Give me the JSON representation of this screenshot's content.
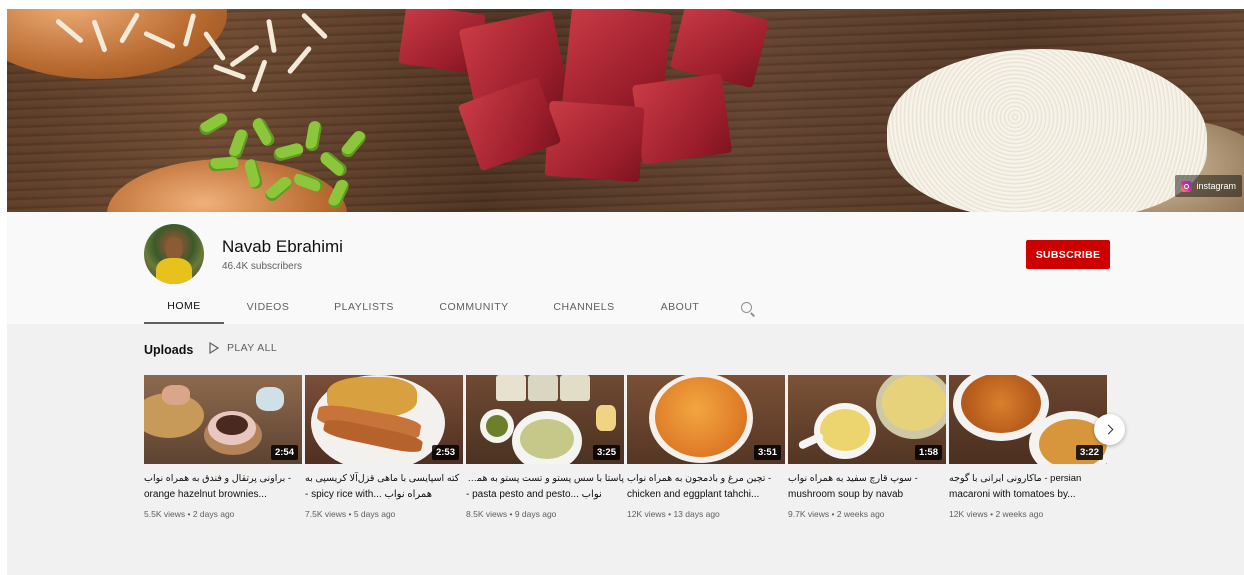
{
  "banner": {
    "social_link_label": "instagram",
    "social_icon": "instagram-icon"
  },
  "channel": {
    "name": "Navab Ebrahimi",
    "subscribers": "46.4K subscribers",
    "subscribe_label": "SUBSCRIBE",
    "subscribe_color": "#cc0000"
  },
  "tabs": [
    {
      "label": "HOME",
      "active": true
    },
    {
      "label": "VIDEOS",
      "active": false
    },
    {
      "label": "PLAYLISTS",
      "active": false
    },
    {
      "label": "COMMUNITY",
      "active": false
    },
    {
      "label": "CHANNELS",
      "active": false
    },
    {
      "label": "ABOUT",
      "active": false
    }
  ],
  "search_icon": "search-icon",
  "shelf": {
    "title": "Uploads",
    "play_all_label": "PLAY ALL",
    "play_icon": "play-icon",
    "next_icon": "chevron-right-icon"
  },
  "videos": [
    {
      "duration": "2:54",
      "title_line1": "- براونی پرتقال و فندق به همراه نواب",
      "title_line2": "orange hazelnut brownies...",
      "views": "5.5K views",
      "age": "2 days ago"
    },
    {
      "duration": "2:53",
      "title_line1": "کته اسپایسی با ماهی قزل‌آلا کریسپی به",
      "title_line2": "- spicy rice with... همراه نواب",
      "views": "7.5K views",
      "age": "5 days ago"
    },
    {
      "duration": "3:25",
      "title_line1": "پاستا با سس پستو و تست پستو به همراه",
      "title_line2": "- pasta pesto and pesto... نواب",
      "views": "8.5K views",
      "age": "9 days ago"
    },
    {
      "duration": "3:51",
      "title_line1": "- تچین مرغ و بادمجون به همراه نواب",
      "title_line2": "chicken and eggplant tahchi...",
      "views": "12K views",
      "age": "13 days ago"
    },
    {
      "duration": "1:58",
      "title_line1": "- سوپ قارچ سفید به همراه نواب",
      "title_line2": "mushroom soup by navab",
      "views": "9.7K views",
      "age": "2 weeks ago"
    },
    {
      "duration": "3:22",
      "title_line1": "persian - ماکارونی ایرانی با گوجه",
      "title_line2": "macaroni with tomatoes by...",
      "views": "12K views",
      "age": "2 weeks ago"
    }
  ]
}
